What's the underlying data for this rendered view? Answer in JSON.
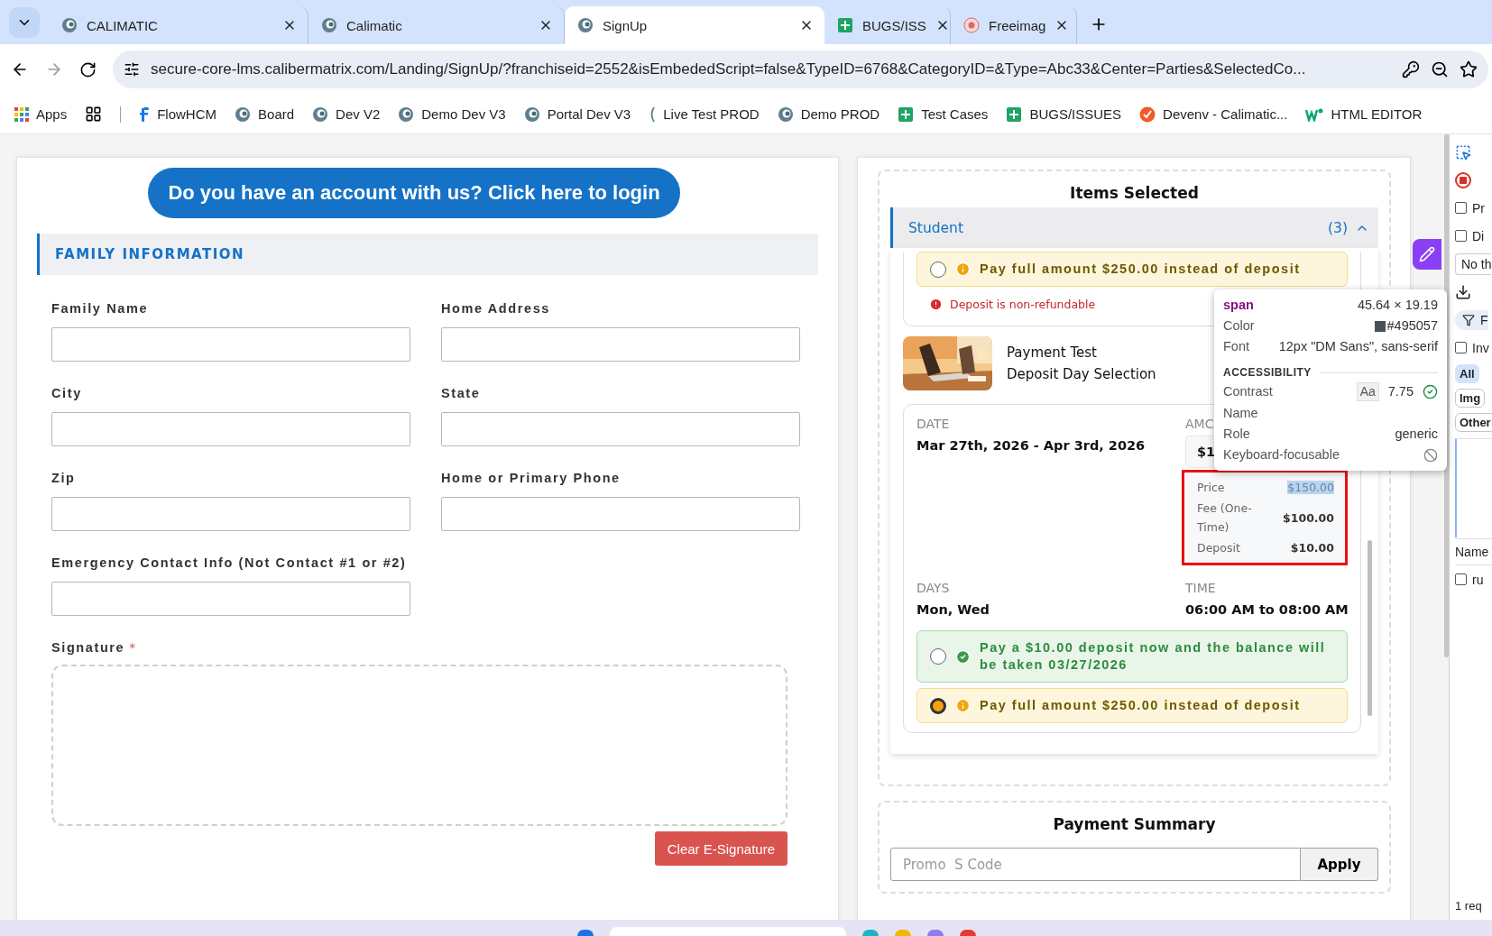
{
  "browser": {
    "tabs": [
      {
        "title": "CALIMATIC",
        "selected": false
      },
      {
        "title": "Calimatic",
        "selected": false
      },
      {
        "title": "SignUp",
        "selected": true
      },
      {
        "title": "BUGS/ISS",
        "selected": false
      },
      {
        "title": "Freeimag",
        "selected": false
      }
    ],
    "url": "secure-core-lms.calibermatrix.com/Landing/SignUp/?franchiseid=2552&isEmbededScript=false&TypeID=6768&CategoryID=&Type=Abc33&Center=Parties&SelectedCo...",
    "bookmarks": [
      {
        "label": "Apps"
      },
      {
        "label": "FlowHCM"
      },
      {
        "label": "Board"
      },
      {
        "label": "Dev V2"
      },
      {
        "label": "Demo Dev V3"
      },
      {
        "label": "Portal Dev V3"
      },
      {
        "label": "Live Test PROD"
      },
      {
        "label": "Demo PROD"
      },
      {
        "label": "Test Cases"
      },
      {
        "label": "BUGS/ISSUES"
      },
      {
        "label": "Devenv - Calimatic..."
      },
      {
        "label": "HTML EDITOR"
      }
    ]
  },
  "family_form": {
    "login_button": "Do you have an account with us? Click here to login",
    "section_title": "FAMILY INFORMATION",
    "fields": [
      {
        "label": "Family Name"
      },
      {
        "label": "Home Address"
      },
      {
        "label": "City"
      },
      {
        "label": "State"
      },
      {
        "label": "Zip"
      },
      {
        "label": "Home or Primary Phone"
      },
      {
        "label": "Emergency Contact Info (Not Contact #1 or #2)"
      }
    ],
    "signature": {
      "label": "Signature",
      "required_mark": "*"
    },
    "clear_button": "Clear E-Signature"
  },
  "items_selected": {
    "title": "Items Selected",
    "group": {
      "name": "Student",
      "count": "(3)",
      "expanded": true
    },
    "first_item": {
      "options": [
        {
          "kind": "full",
          "text": "Pay full amount $250.00 instead of deposit",
          "selected": false
        }
      ],
      "note": "Deposit is non-refundable"
    },
    "second_item": {
      "name": "Payment Test",
      "subtitle": "Deposit Day Selection",
      "date_label": "DATE",
      "date": "Mar 27th, 2026 - Apr 3rd, 2026",
      "amount_label": "AMC",
      "amount": "$1",
      "price_rows": [
        {
          "label": "Price",
          "value": "$150.00",
          "highlighted": true
        },
        {
          "label": "Fee (One-Time)",
          "value": "$100.00",
          "highlighted": false
        },
        {
          "label": "Deposit",
          "value": "$10.00",
          "highlighted": false
        }
      ],
      "inspected": true,
      "days_label": "DAYS",
      "days": "Mon, Wed",
      "time_label": "TIME",
      "time": "06:00 AM to 08:00 AM",
      "options": [
        {
          "kind": "deposit",
          "text": "Pay a $10.00 deposit now and the balance will be taken 03/27/2026",
          "selected": false
        },
        {
          "kind": "full",
          "text": "Pay full amount $250.00 instead of deposit",
          "selected": true
        }
      ]
    }
  },
  "payment_summary": {
    "title": "Payment Summary",
    "promo_placeholder": "Promo  S Code",
    "apply_button": "Apply"
  },
  "inspect_tooltip": {
    "tag": "span",
    "size": "45.64 × 19.19",
    "color_label": "Color",
    "color_value": "#495057",
    "font_label": "Font",
    "font_value": "12px \"DM Sans\", sans-serif",
    "section": "ACCESSIBILITY",
    "contrast_label": "Contrast",
    "contrast_sample": "Aa",
    "contrast_value": "7.75",
    "name_label": "Name",
    "role_label": "Role",
    "role_value": "generic",
    "focus_label": "Keyboard-focusable"
  },
  "devtools": {
    "items": [
      {
        "kind": "inspect"
      },
      {
        "kind": "record"
      },
      {
        "kind": "checkbox",
        "label": "Pr",
        "checked": false
      },
      {
        "kind": "checkbox",
        "label": "Di",
        "checked": false
      },
      {
        "kind": "select",
        "label": "No th"
      },
      {
        "kind": "download"
      },
      {
        "kind": "filter",
        "label": "F"
      },
      {
        "kind": "checkbox",
        "label": "Inv",
        "checked": false
      },
      {
        "kind": "chip",
        "label": "All",
        "selected": true
      },
      {
        "kind": "chip",
        "label": "Img",
        "selected": false
      },
      {
        "kind": "chip",
        "label": "Other",
        "selected": false
      },
      {
        "kind": "timeline"
      },
      {
        "kind": "header",
        "label": "Name"
      },
      {
        "kind": "checkbox",
        "label": "ru",
        "checked": false
      }
    ],
    "status": "1 req"
  }
}
